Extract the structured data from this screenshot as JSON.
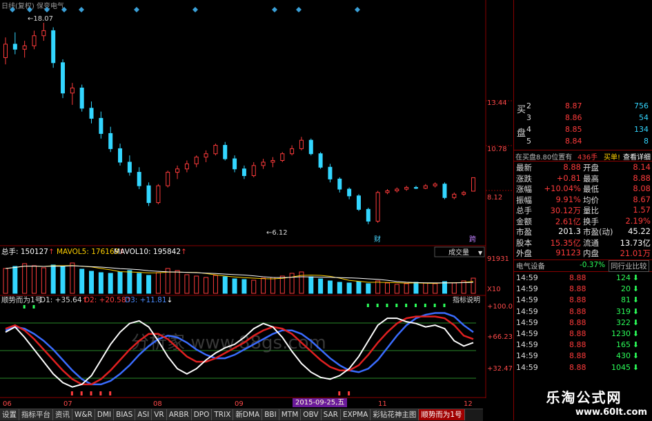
{
  "header": {
    "title": "日线(复权) 保变电气"
  },
  "price_axis": [
    "13.44",
    "10.78",
    "8.12"
  ],
  "price_marks": {
    "high": "18.07",
    "low": "6.12"
  },
  "event_tags": [
    "财",
    "跨"
  ],
  "volume_panel": {
    "label_total": "总手: 150127",
    "label_mavol5": "MAVOL5: 176169",
    "label_mavol10": "MAVOL10: 195842",
    "button": "成交量",
    "axis_top": "91931",
    "axis_unit": "X10"
  },
  "indicator_panel": {
    "name": "顺势而为1号",
    "d1": "D1: +35.64",
    "d2": "D2: +20.58",
    "d3": "D3: +11.81",
    "button": "指标说明",
    "axis": [
      "+100.0",
      "+66.23",
      "+32.47"
    ],
    "watermark": "分析家 www.88gs.com"
  },
  "date_axis": {
    "labels": [
      "06",
      "07",
      "08",
      "09",
      "11",
      "12"
    ],
    "badge": "2015-09-25,五"
  },
  "order_book": {
    "side_label_chars": [
      "买",
      "盘"
    ],
    "rows": [
      {
        "level": "2",
        "price": "8.87",
        "vol": "756"
      },
      {
        "level": "3",
        "price": "8.86",
        "vol": "54"
      },
      {
        "level": "4",
        "price": "8.85",
        "vol": "134"
      },
      {
        "level": "5",
        "price": "8.84",
        "vol": "8"
      }
    ],
    "status": "在买盘8.80位置有",
    "status_vol": "436手",
    "status_btn1": "买单!",
    "status_btn2": "查看详细"
  },
  "quote": [
    {
      "l1": "最新",
      "v1": "8.88",
      "l2": "开盘",
      "v2": "8.14"
    },
    {
      "l1": "涨跌",
      "v1": "+0.81",
      "l2": "最高",
      "v2": "8.88"
    },
    {
      "l1": "涨幅",
      "v1": "+10.04%",
      "l2": "最低",
      "v2": "8.08"
    },
    {
      "l1": "振幅",
      "v1": "9.91%",
      "l2": "均价",
      "v2": "8.67"
    },
    {
      "l1": "总手",
      "v1": "30.12万",
      "l2": "量比",
      "v2": "1.57"
    },
    {
      "l1": "金额",
      "v1": "2.61亿",
      "l2": "换手",
      "v2": "2.19%"
    },
    {
      "l1": "市盈",
      "v1": "201.3",
      "l2": "市盈(动)",
      "v2": "45.22"
    },
    {
      "l1": "股本",
      "v1": "15.35亿",
      "l2": "流通",
      "v2": "13.73亿"
    },
    {
      "l1": "外盘",
      "v1": "91123",
      "l2": "内盘",
      "v2": "21.01万"
    }
  ],
  "sector": {
    "name": "电气设备",
    "change": "-0.37%",
    "button": "同行业比较"
  },
  "trades": [
    {
      "time": "14:59",
      "price": "8.88",
      "vol": "124"
    },
    {
      "time": "14:59",
      "price": "8.88",
      "vol": "20"
    },
    {
      "time": "14:59",
      "price": "8.88",
      "vol": "81"
    },
    {
      "time": "14:59",
      "price": "8.88",
      "vol": "319"
    },
    {
      "time": "14:59",
      "price": "8.88",
      "vol": "322"
    },
    {
      "time": "14:59",
      "price": "8.88",
      "vol": "1230"
    },
    {
      "time": "14:59",
      "price": "8.88",
      "vol": "165"
    },
    {
      "time": "14:59",
      "price": "8.88",
      "vol": "430"
    },
    {
      "time": "14:59",
      "price": "8.88",
      "vol": "1045"
    }
  ],
  "tabs": [
    "设置",
    "指标平台",
    "资讯",
    "W&R",
    "DMI",
    "BIAS",
    "ASI",
    "VR",
    "ARBR",
    "DPO",
    "TRIX",
    "新DMA",
    "BBI",
    "MTM",
    "OBV",
    "SAR",
    "EXPMA",
    "彩钻花神主图",
    "顺势而为1号"
  ],
  "active_tab": "顺势而为1号",
  "site_watermark": {
    "name": "乐淘公式网",
    "url": "www.60lt.com"
  },
  "colors": {
    "up": "#ff3b3b",
    "down": "#33d6ff",
    "white_line": "#ffffff",
    "grid": "#8a0000"
  },
  "chart_data": {
    "type": "line",
    "title": "",
    "xlabel": "",
    "ylabel": "",
    "x_ticks": [
      "06",
      "07",
      "08",
      "09",
      "11",
      "12"
    ],
    "candles": [
      [
        16.0,
        17.2,
        15.6,
        16.8
      ],
      [
        16.8,
        17.5,
        16.2,
        16.5
      ],
      [
        16.5,
        17.0,
        16.0,
        16.7
      ],
      [
        16.7,
        17.6,
        16.5,
        17.3
      ],
      [
        17.3,
        18.07,
        17.0,
        17.6
      ],
      [
        17.6,
        17.8,
        15.4,
        15.7
      ],
      [
        15.7,
        15.9,
        13.6,
        13.9
      ],
      [
        13.9,
        14.5,
        13.2,
        14.2
      ],
      [
        14.2,
        14.4,
        12.8,
        13.0
      ],
      [
        13.0,
        13.4,
        12.1,
        12.4
      ],
      [
        12.4,
        12.8,
        11.2,
        11.5
      ],
      [
        11.5,
        11.9,
        10.4,
        10.6
      ],
      [
        10.6,
        10.9,
        9.6,
        9.8
      ],
      [
        9.8,
        10.2,
        9.0,
        9.2
      ],
      [
        9.2,
        9.5,
        8.2,
        8.4
      ],
      [
        8.4,
        8.6,
        7.2,
        7.4
      ],
      [
        7.4,
        8.5,
        7.3,
        8.4
      ],
      [
        8.4,
        9.3,
        8.3,
        9.2
      ],
      [
        9.2,
        9.6,
        8.8,
        9.4
      ],
      [
        9.4,
        9.9,
        9.2,
        9.7
      ],
      [
        9.7,
        10.2,
        9.5,
        10.1
      ],
      [
        10.1,
        10.5,
        9.8,
        10.3
      ],
      [
        10.3,
        10.9,
        10.2,
        10.8
      ],
      [
        10.8,
        11.0,
        9.9,
        10.0
      ],
      [
        10.0,
        10.2,
        9.2,
        9.4
      ],
      [
        9.4,
        9.6,
        8.8,
        9.0
      ],
      [
        9.0,
        9.8,
        8.9,
        9.6
      ],
      [
        9.6,
        10.0,
        9.4,
        9.8
      ],
      [
        9.8,
        10.1,
        9.5,
        9.9
      ],
      [
        9.9,
        10.4,
        9.8,
        10.3
      ],
      [
        10.3,
        10.8,
        10.2,
        10.6
      ],
      [
        10.6,
        11.3,
        10.5,
        11.1
      ],
      [
        11.1,
        11.2,
        10.2,
        10.3
      ],
      [
        10.3,
        10.4,
        9.4,
        9.5
      ],
      [
        9.5,
        9.7,
        8.6,
        8.8
      ],
      [
        8.8,
        8.9,
        8.0,
        8.2
      ],
      [
        8.2,
        8.3,
        7.6,
        7.8
      ],
      [
        7.8,
        7.9,
        6.9,
        7.0
      ],
      [
        7.0,
        7.1,
        6.12,
        6.3
      ],
      [
        6.3,
        8.1,
        6.2,
        8.0
      ],
      [
        8.0,
        8.2,
        7.9,
        8.1
      ],
      [
        8.1,
        8.3,
        8.0,
        8.2
      ],
      [
        8.2,
        8.4,
        8.1,
        8.3
      ],
      [
        8.3,
        8.4,
        8.2,
        8.25
      ],
      [
        8.25,
        8.5,
        8.2,
        8.4
      ],
      [
        8.4,
        8.6,
        8.3,
        8.5
      ],
      [
        8.5,
        8.6,
        7.6,
        7.7
      ],
      [
        7.7,
        8.0,
        7.6,
        7.9
      ],
      [
        7.9,
        8.1,
        7.8,
        8.0
      ],
      [
        8.08,
        8.88,
        8.08,
        8.88
      ]
    ],
    "indicator": {
      "white": [
        72,
        78,
        66,
        52,
        38,
        24,
        14,
        9,
        12,
        22,
        40,
        58,
        72,
        82,
        85,
        78,
        62,
        44,
        30,
        24,
        30,
        40,
        48,
        54,
        58,
        66,
        76,
        82,
        78,
        66,
        50,
        36,
        26,
        20,
        18,
        22,
        30,
        44,
        62,
        80,
        88,
        88,
        84,
        82,
        78,
        80,
        76,
        62,
        56,
        60
      ],
      "red": [
        76,
        80,
        74,
        64,
        52,
        40,
        28,
        18,
        12,
        12,
        18,
        28,
        40,
        52,
        62,
        70,
        70,
        64,
        54,
        44,
        38,
        38,
        42,
        48,
        54,
        60,
        68,
        74,
        78,
        76,
        70,
        60,
        50,
        40,
        32,
        28,
        28,
        34,
        46,
        60,
        72,
        82,
        88,
        90,
        90,
        90,
        88,
        80,
        68,
        64
      ],
      "blue": [
        74,
        78,
        76,
        70,
        62,
        52,
        40,
        28,
        18,
        12,
        12,
        16,
        24,
        34,
        46,
        56,
        64,
        68,
        66,
        60,
        52,
        46,
        42,
        42,
        46,
        52,
        58,
        64,
        70,
        74,
        74,
        70,
        62,
        52,
        42,
        34,
        28,
        26,
        30,
        40,
        54,
        68,
        80,
        88,
        92,
        94,
        94,
        90,
        80,
        72
      ],
      "ylim": [
        0,
        100
      ]
    },
    "volume": [
      72,
      78,
      86,
      80,
      74,
      82,
      78,
      88,
      70,
      64,
      60,
      58,
      62,
      66,
      58,
      52,
      60,
      72,
      66,
      54,
      50,
      46,
      52,
      48,
      42,
      40,
      38,
      44,
      46,
      50,
      58,
      62,
      48,
      42,
      36,
      32,
      30,
      34,
      28,
      36,
      30,
      26,
      28,
      32,
      30,
      28,
      34,
      30,
      36,
      44
    ],
    "volume_ylim": [
      0,
      91931
    ]
  }
}
